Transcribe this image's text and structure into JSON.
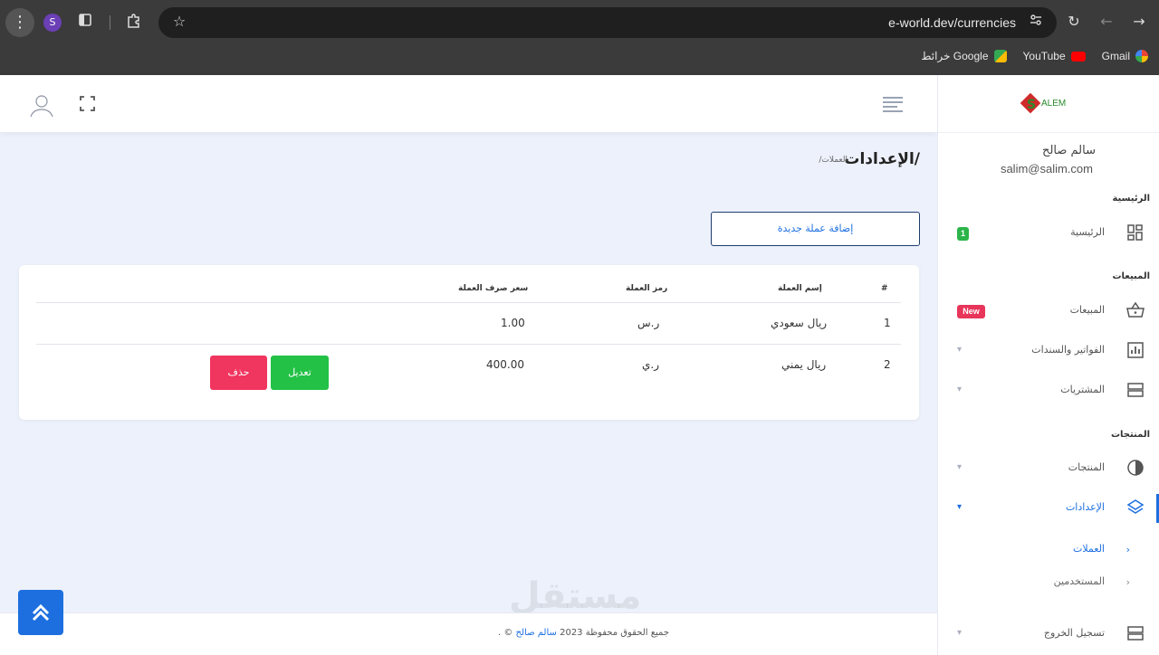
{
  "browser": {
    "url": "e-world.dev/currencies",
    "profile_initial": "S",
    "bookmarks": [
      {
        "label": "Gmail",
        "color": "#4285f4"
      },
      {
        "label": "YouTube",
        "color": "#ff0000"
      },
      {
        "label": "خرائط Google",
        "color": "#34a853"
      }
    ]
  },
  "sidebar": {
    "user_name": "سالم صالح",
    "user_email": "salim@salim.com",
    "logo_text": "ALEM",
    "sections": {
      "home": "الرئيسية",
      "sales": "المبيعات",
      "products": "المنتجات"
    },
    "items": {
      "home": {
        "label": "الرئيسية",
        "badge": "1"
      },
      "sales": {
        "label": "المبيعات",
        "badge": "New"
      },
      "invoices": {
        "label": "الفواتير والسندات"
      },
      "purchases": {
        "label": "المشتريات"
      },
      "products": {
        "label": "المنتجات"
      },
      "settings": {
        "label": "الإعدادات"
      },
      "logout": {
        "label": "تسجيل الخروج"
      }
    },
    "sub_items": {
      "currencies": "العملات",
      "users": "المستخدمين"
    }
  },
  "main": {
    "title": "الإعدادات/",
    "breadcrumb": "/العملات",
    "add_button": "إضافة عملة جديدة",
    "table": {
      "headers": [
        "#",
        "إسم العملة",
        "رمز العملة",
        "سعر صرف العملة"
      ],
      "rows": [
        {
          "num": "1",
          "name": "ريال سعودي",
          "symbol": "ر.س",
          "rate": "1.00"
        },
        {
          "num": "2",
          "name": "ريال يمني",
          "symbol": "ر.ي",
          "rate": "400.00",
          "edit": "تعديل",
          "delete": "حذف"
        }
      ]
    }
  },
  "footer": {
    "text": "جميع الحقوق محفوظة 2023",
    "link": "سالم صالح",
    "suffix": "© ."
  },
  "watermark": "مستقل",
  "colors": {
    "primary": "#1d6fe0",
    "edit": "#23c146",
    "delete": "#f0355f",
    "badge_green": "#2bb44a",
    "badge_red": "#e8355a"
  }
}
